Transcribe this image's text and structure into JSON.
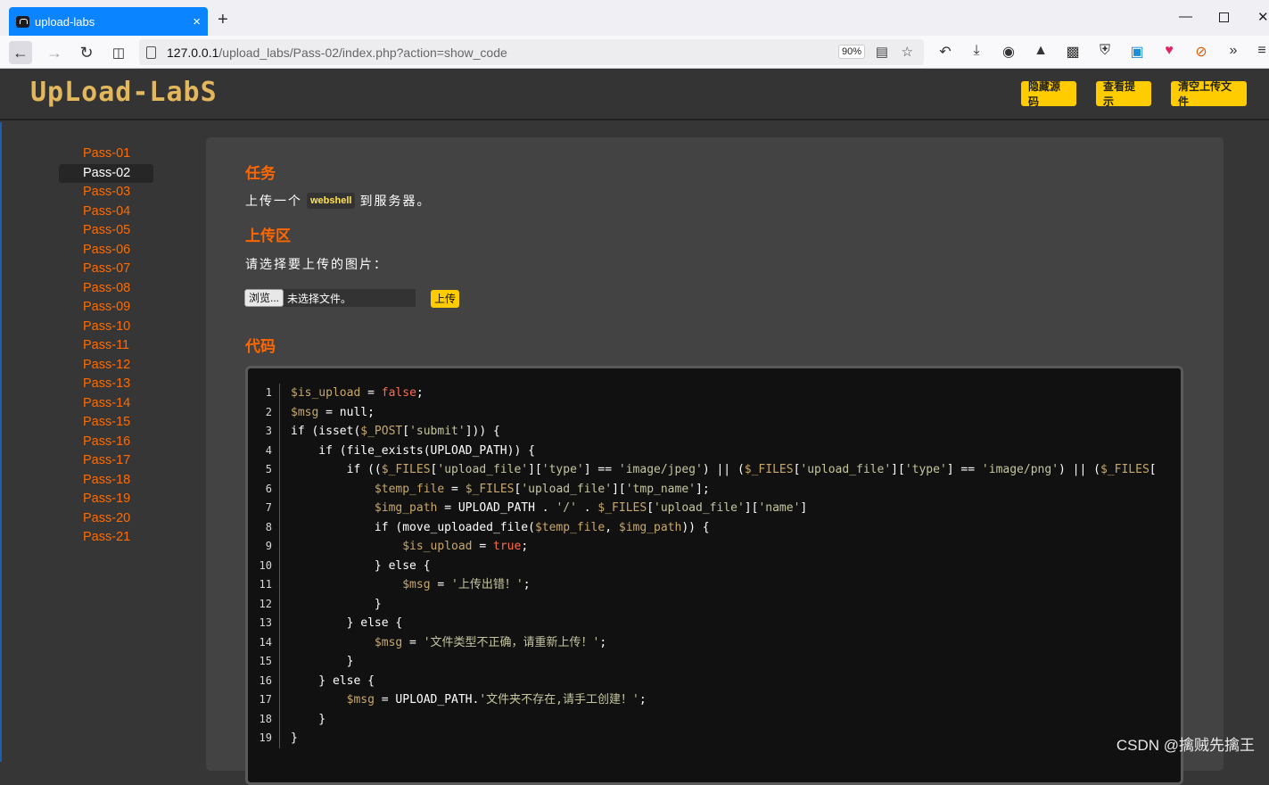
{
  "browser": {
    "tab_title": "upload-labs",
    "tab_close": "×",
    "new_tab": "+",
    "url_host": "127.0.0.1",
    "url_path": "/upload_labs/Pass-02/index.php?action=show_code",
    "zoom": "90%"
  },
  "header": {
    "logo": "UpLoad-LabS",
    "buttons": [
      "隐藏源码",
      "查看提示",
      "清空上传文件"
    ]
  },
  "sidebar": {
    "items": [
      "Pass-01",
      "Pass-02",
      "Pass-03",
      "Pass-04",
      "Pass-05",
      "Pass-06",
      "Pass-07",
      "Pass-08",
      "Pass-09",
      "Pass-10",
      "Pass-11",
      "Pass-12",
      "Pass-13",
      "Pass-14",
      "Pass-15",
      "Pass-16",
      "Pass-17",
      "Pass-18",
      "Pass-19",
      "Pass-20",
      "Pass-21"
    ],
    "active": "Pass-02"
  },
  "task": {
    "title": "任务",
    "text_before": "上传一个",
    "badge": "webshell",
    "text_after": "到服务器。"
  },
  "upload": {
    "title": "上传区",
    "prompt": "请选择要上传的图片：",
    "browse_label": "浏览...",
    "file_status": "未选择文件。",
    "submit_label": "上传"
  },
  "code": {
    "title": "代码",
    "lines": [
      "$is_upload = false;",
      "$msg = null;",
      "if (isset($_POST['submit'])) {",
      "    if (file_exists(UPLOAD_PATH)) {",
      "        if (($_FILES['upload_file']['type'] == 'image/jpeg') || ($_FILES['upload_file']['type'] == 'image/png') || ($_FILES[",
      "            $temp_file = $_FILES['upload_file']['tmp_name'];",
      "            $img_path = UPLOAD_PATH . '/' . $_FILES['upload_file']['name']",
      "            if (move_uploaded_file($temp_file, $img_path)) {",
      "                $is_upload = true;",
      "            } else {",
      "                $msg = '上传出错！';",
      "            }",
      "        } else {",
      "            $msg = '文件类型不正确，请重新上传！';",
      "        }",
      "    } else {",
      "        $msg = UPLOAD_PATH.'文件夹不存在,请手工创建！';",
      "    }",
      "}"
    ]
  },
  "watermark": "CSDN @擒贼先擒王"
}
